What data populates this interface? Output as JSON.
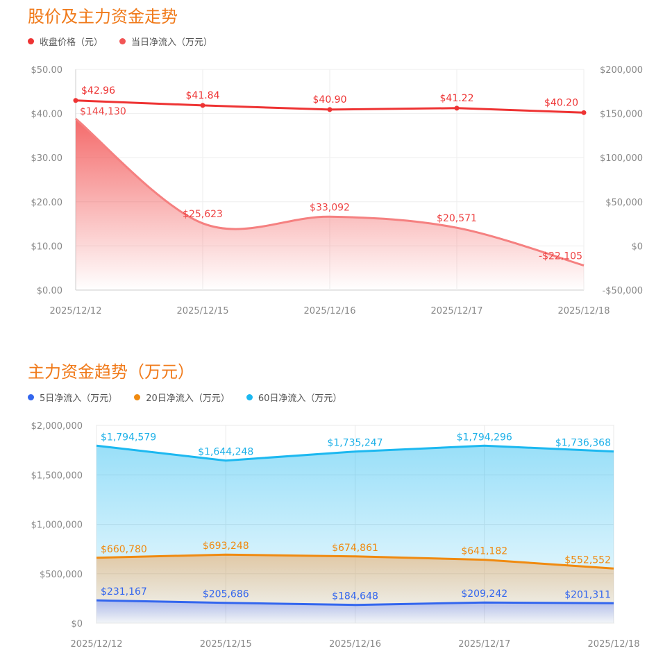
{
  "charts": [
    {
      "title": "股价及主力资金走势",
      "legend": [
        {
          "name": "收盘价格（元）",
          "color": "#ee3333"
        },
        {
          "name": "当日净流入（万元）",
          "color": "#f25555"
        }
      ]
    },
    {
      "title": "主力资金趋势（万元）",
      "legend": [
        {
          "name": "5日净流入（万元）",
          "color": "#3366ee"
        },
        {
          "name": "20日净流入（万元）",
          "color": "#f08a10"
        },
        {
          "name": "60日净流入（万元）",
          "color": "#1cb8f0"
        }
      ]
    }
  ],
  "chart_data": [
    {
      "type": "line",
      "title": "股价及主力资金走势",
      "categories": [
        "2025/12/12",
        "2025/12/15",
        "2025/12/16",
        "2025/12/17",
        "2025/12/18"
      ],
      "y_left": {
        "min": 0,
        "max": 50,
        "ticks": [
          0,
          10,
          20,
          30,
          40,
          50
        ],
        "tick_labels": [
          "$0.00",
          "$10.00",
          "$20.00",
          "$30.00",
          "$40.00",
          "$50.00"
        ]
      },
      "y_right": {
        "min": -50000,
        "max": 200000,
        "ticks": [
          -50000,
          0,
          50000,
          100000,
          150000,
          200000
        ],
        "tick_labels": [
          "-$50,000",
          "$0",
          "$50,000",
          "$100,000",
          "$150,000",
          "$200,000"
        ]
      },
      "series": [
        {
          "name": "收盘价格（元）",
          "axis": "left",
          "color": "#ee3333",
          "values": [
            42.96,
            41.84,
            40.9,
            41.22,
            40.2
          ],
          "labels": [
            "$42.96",
            "$41.84",
            "$40.90",
            "$41.22",
            "$40.20"
          ]
        },
        {
          "name": "当日净流入（万元）",
          "axis": "right",
          "color": "#f58080",
          "values": [
            144130,
            25623,
            33092,
            20571,
            -22105
          ],
          "labels": [
            "$144,130",
            "$25,623",
            "$33,092",
            "$20,571",
            "-$22,105"
          ]
        }
      ]
    },
    {
      "type": "area",
      "title": "主力资金趋势（万元）",
      "categories": [
        "2025/12/12",
        "2025/12/15",
        "2025/12/16",
        "2025/12/17",
        "2025/12/18"
      ],
      "y": {
        "min": 0,
        "max": 2000000,
        "ticks": [
          0,
          500000,
          1000000,
          1500000,
          2000000
        ],
        "tick_labels": [
          "$0",
          "$500,000",
          "$1,000,000",
          "$1,500,000",
          "$2,000,000"
        ]
      },
      "series": [
        {
          "name": "60日净流入（万元）",
          "color": "#1cb8f0",
          "values": [
            1794579,
            1644248,
            1735247,
            1794296,
            1736368
          ],
          "labels": [
            "$1,794,579",
            "$1,644,248",
            "$1,735,247",
            "$1,794,296",
            "$1,736,368"
          ]
        },
        {
          "name": "20日净流入（万元）",
          "color": "#f08a10",
          "values": [
            660780,
            693248,
            674861,
            641182,
            552552
          ],
          "labels": [
            "$660,780",
            "$693,248",
            "$674,861",
            "$641,182",
            "$552,552"
          ]
        },
        {
          "name": "5日净流入（万元）",
          "color": "#3366ee",
          "values": [
            231167,
            205686,
            184648,
            209242,
            201311
          ],
          "labels": [
            "$231,167",
            "$205,686",
            "$184,648",
            "$209,242",
            "$201,311"
          ]
        }
      ]
    }
  ]
}
